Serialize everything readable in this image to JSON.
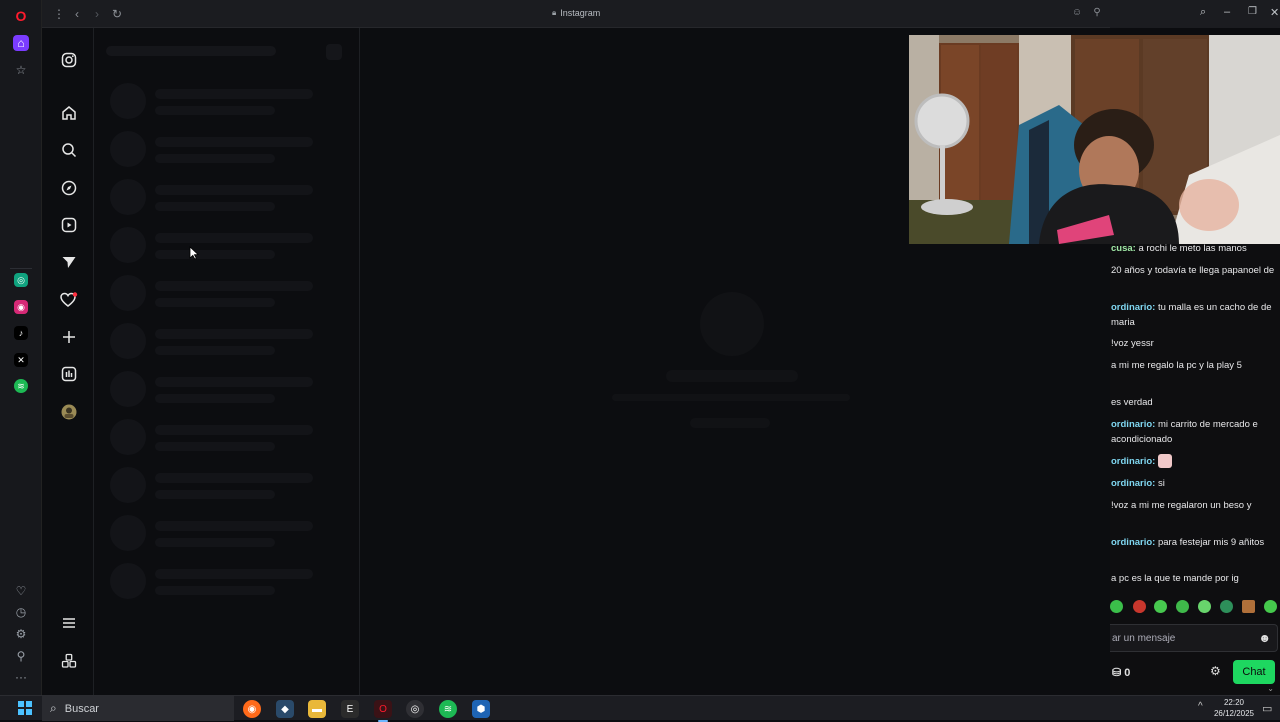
{
  "browser": {
    "tab_title": "Instagram",
    "nav": {
      "menu": "⋮",
      "back": "‹",
      "forward": "›",
      "reload": "↻"
    }
  },
  "chat": {
    "messages": [
      {
        "user": "cusa:",
        "text": " a rochi le meto las manos",
        "user_class": "c1"
      },
      {
        "user": "",
        "text": "20 años y todavía te llega papanoel de",
        "user_class": "c1"
      },
      {
        "user": "ordinario:",
        "text": " tu malla es un cacho de de maria",
        "user_class": "c2"
      },
      {
        "user": "",
        "text": "!voz yessr",
        "user_class": "c1"
      },
      {
        "user": "",
        "text": "a mi me regalo la pc y la play 5",
        "user_class": "c1"
      },
      {
        "user": "",
        "text": "es verdad",
        "user_class": "c1"
      },
      {
        "user": "ordinario:",
        "text": " mi carrito de mercado e acondicionado",
        "user_class": "c2"
      },
      {
        "user": "ordinario:",
        "text": "",
        "user_class": "c2"
      },
      {
        "user": "ordinario:",
        "text": " si",
        "user_class": "c2"
      },
      {
        "user": "",
        "text": "!voz a mi me regalaron un beso y",
        "user_class": "c1"
      },
      {
        "user": "ordinario:",
        "text": " para festejar mis 9 añitos",
        "user_class": "c2"
      },
      {
        "user": "",
        "text": "a pc es la que te mande por ig",
        "user_class": "c1"
      }
    ],
    "input_placeholder": "ar un mensaje",
    "points": "0",
    "send_label": "Chat"
  },
  "taskbar": {
    "search_placeholder": "Buscar",
    "time": "22:20",
    "date": "26/12/2025"
  },
  "colors": {
    "opera_red": "#ff1b2d",
    "twitch_green": "#1ed760",
    "background": "#0c0d10"
  }
}
